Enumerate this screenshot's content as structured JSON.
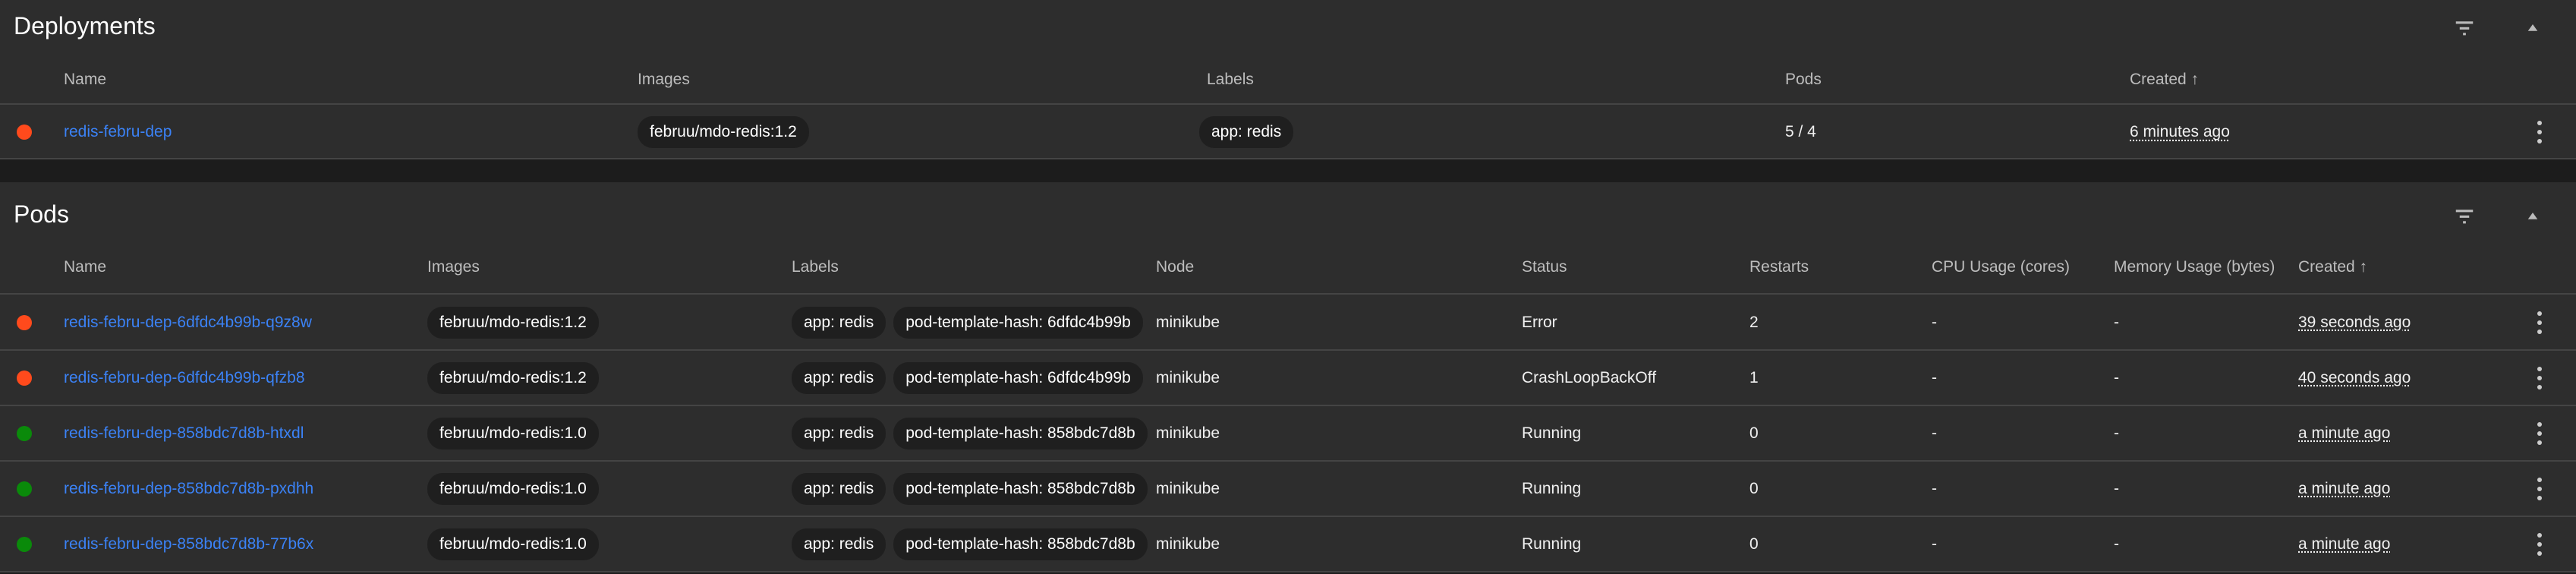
{
  "colors": {
    "error": "#ff4a1c",
    "running": "#0a8a0a",
    "link": "#3b82f6"
  },
  "deployments": {
    "title": "Deployments",
    "columns": [
      "Name",
      "Images",
      "Labels",
      "Pods",
      "Created ↑"
    ],
    "rows": [
      {
        "status": "error",
        "name": "redis-febru-dep",
        "images": [
          "februu/mdo-redis:1.2"
        ],
        "labels": [
          "app: redis"
        ],
        "pods": "5 / 4",
        "created": "6 minutes ago"
      }
    ]
  },
  "pods": {
    "title": "Pods",
    "columns": [
      "Name",
      "Images",
      "Labels",
      "Node",
      "Status",
      "Restarts",
      "CPU Usage (cores)",
      "Memory Usage (bytes)",
      "Created ↑"
    ],
    "rows": [
      {
        "status": "error",
        "name": "redis-febru-dep-6dfdc4b99b-q9z8w",
        "image": "februu/mdo-redis:1.2",
        "labels": [
          "app: redis",
          "pod-template-hash: 6dfdc4b99b"
        ],
        "node": "minikube",
        "state": "Error",
        "restarts": "2",
        "cpu": "-",
        "memory": "-",
        "created": "39 seconds ago"
      },
      {
        "status": "error",
        "name": "redis-febru-dep-6dfdc4b99b-qfzb8",
        "image": "februu/mdo-redis:1.2",
        "labels": [
          "app: redis",
          "pod-template-hash: 6dfdc4b99b"
        ],
        "node": "minikube",
        "state": "CrashLoopBackOff",
        "restarts": "1",
        "cpu": "-",
        "memory": "-",
        "created": "40 seconds ago"
      },
      {
        "status": "running",
        "name": "redis-febru-dep-858bdc7d8b-htxdl",
        "image": "februu/mdo-redis:1.0",
        "labels": [
          "app: redis",
          "pod-template-hash: 858bdc7d8b"
        ],
        "node": "minikube",
        "state": "Running",
        "restarts": "0",
        "cpu": "-",
        "memory": "-",
        "created": "a minute ago"
      },
      {
        "status": "running",
        "name": "redis-febru-dep-858bdc7d8b-pxdhh",
        "image": "februu/mdo-redis:1.0",
        "labels": [
          "app: redis",
          "pod-template-hash: 858bdc7d8b"
        ],
        "node": "minikube",
        "state": "Running",
        "restarts": "0",
        "cpu": "-",
        "memory": "-",
        "created": "a minute ago"
      },
      {
        "status": "running",
        "name": "redis-febru-dep-858bdc7d8b-77b6x",
        "image": "februu/mdo-redis:1.0",
        "labels": [
          "app: redis",
          "pod-template-hash: 858bdc7d8b"
        ],
        "node": "minikube",
        "state": "Running",
        "restarts": "0",
        "cpu": "-",
        "memory": "-",
        "created": "a minute ago"
      }
    ]
  }
}
